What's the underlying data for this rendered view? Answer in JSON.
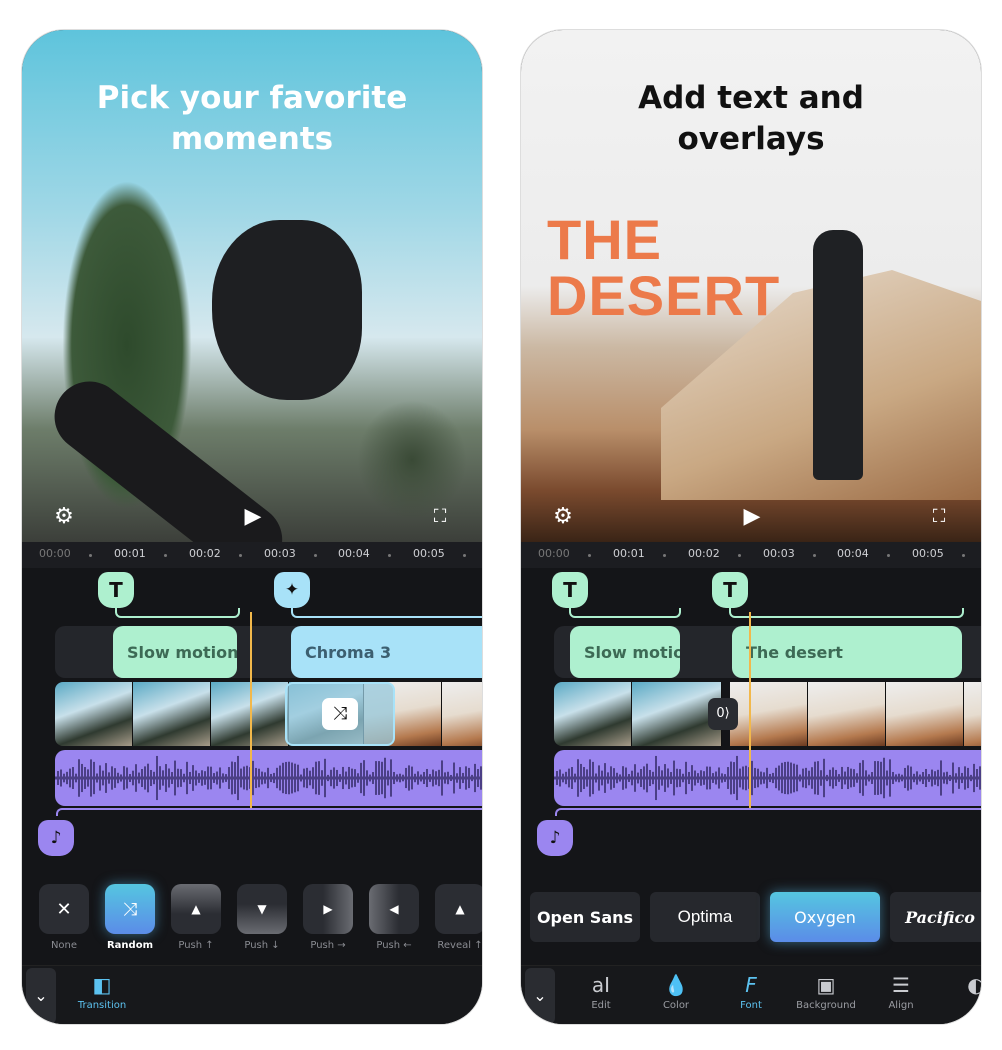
{
  "colors": {
    "accent": "#5cc2f0",
    "text_caption": "#aef0cf",
    "effect": "#a8e2f8",
    "audio": "#9b86f0",
    "playhead": "#f2b84b",
    "title_orange": "#ec7a4a"
  },
  "ruler": [
    "00:00",
    "00:01",
    "00:02",
    "00:03",
    "00:04",
    "00:05"
  ],
  "screen1": {
    "headline": [
      "Pick your favorite",
      "moments"
    ],
    "icons": {
      "settings": "gear-icon",
      "play": "play-icon",
      "fullscreen": "fullscreen-icon"
    },
    "clips": {
      "text": "Slow motion",
      "effect": "Chroma 3"
    },
    "transitions": [
      {
        "label": "None",
        "icon": "close-icon"
      },
      {
        "label": "Random",
        "icon": "shuffle-icon",
        "selected": true
      },
      {
        "label": "Push ↑",
        "icon": "triangle-up"
      },
      {
        "label": "Push ↓",
        "icon": "triangle-down"
      },
      {
        "label": "Push →",
        "icon": "triangle-right"
      },
      {
        "label": "Push ←",
        "icon": "triangle-left"
      },
      {
        "label": "Reveal ↑",
        "icon": "triangle-up"
      }
    ],
    "tabs": [
      {
        "label": "Transition",
        "icon": "transition-icon",
        "active": true
      }
    ]
  },
  "screen2": {
    "headline": [
      "Add text and",
      "overlays"
    ],
    "overlay_title": [
      "THE",
      "DESERT"
    ],
    "clips": {
      "text1": "Slow motion",
      "text2": "The desert"
    },
    "fonts": [
      {
        "label": "Open Sans"
      },
      {
        "label": "Optima"
      },
      {
        "label": "Oxygen",
        "selected": true
      },
      {
        "label": "Pacifico"
      }
    ],
    "tabs": [
      {
        "label": "Edit",
        "icon": "edit-text-icon"
      },
      {
        "label": "Color",
        "icon": "droplet-icon"
      },
      {
        "label": "Font",
        "icon": "font-icon",
        "active": true
      },
      {
        "label": "Background",
        "icon": "background-icon"
      },
      {
        "label": "Align",
        "icon": "align-icon"
      }
    ]
  }
}
